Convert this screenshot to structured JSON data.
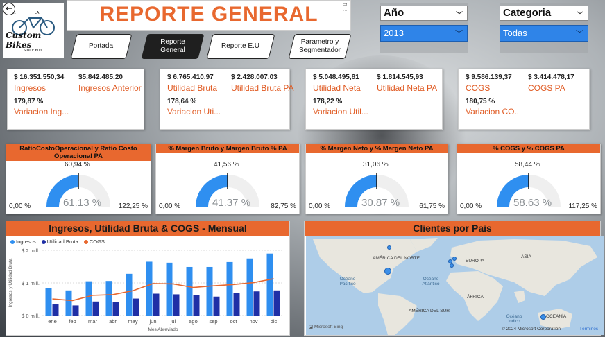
{
  "header": {
    "title": "REPORTE GENERAL",
    "logo": {
      "small_left": "CALIF.",
      "small_right": "LA.",
      "brand": "Custom Bikes",
      "since": "SINCE 60's"
    }
  },
  "nav": {
    "buttons": [
      {
        "label": "Portada"
      },
      {
        "label": "Reporte General"
      },
      {
        "label": "Reporte E.U"
      },
      {
        "label": "Parametro y Segmentador"
      }
    ]
  },
  "slicers": {
    "year": {
      "label": "Año",
      "value": "2013"
    },
    "category": {
      "label": "Categoria",
      "value": "Todas"
    }
  },
  "kpi_cards": [
    {
      "v1": "$ 16.351.550,34",
      "l1": "Ingresos",
      "v2": "$5.842.485,20",
      "l2": "Ingresos Anterior",
      "v3": "179,87 %",
      "l3": "Variacion Ing..."
    },
    {
      "v1": "$ 6.765.410,97",
      "l1": "Utilidad Bruta",
      "v2": "$ 2.428.007,03",
      "l2": "Utilidad Bruta PA",
      "v3": "178,64 %",
      "l3": "Variacion Uti..."
    },
    {
      "v1": "$ 5.048.495,81",
      "l1": "Utilidad Neta",
      "v2": "$ 1.814.545,93",
      "l2": "Utilidad Neta PA",
      "v3": "178,22 %",
      "l3": "Variacion Util..."
    },
    {
      "v1": "$ 9.586.139,37",
      "l1": "COGS",
      "v2": "$ 3.414.478,17",
      "l2": "COGS PA",
      "v3": "180,75 %",
      "l3": "Variacion CO..."
    }
  ],
  "gauges": [
    {
      "title": "RatioCostoOperacional y Ratio Costo Operacional PA",
      "min": "0,00 %",
      "max": "122,25 %",
      "target": "60,94 %",
      "center": "61.13 %",
      "fill": 0.5
    },
    {
      "title": "% Margen Bruto y Margen Bruto % PA",
      "min": "0,00 %",
      "max": "82,75 %",
      "target": "41,56 %",
      "center": "41.37 %",
      "fill": 0.5
    },
    {
      "title": "% Margen Neto y % Margen Neto PA",
      "min": "0,00 %",
      "max": "61,75 %",
      "target": "31,06 %",
      "center": "30.87 %",
      "fill": 0.5
    },
    {
      "title": "% COGS y % COGS PA",
      "min": "0,00 %",
      "max": "117,25 %",
      "target": "58,44 %",
      "center": "58.63 %",
      "fill": 0.5
    }
  ],
  "chart_panel": {
    "title": "Ingresos, Utilidad Bruta & COGS - Mensual",
    "legend": [
      "Ingresos",
      "Utilidad Bruta",
      "COGS"
    ]
  },
  "colors": {
    "accent": "#e8682f",
    "ingresos": "#2f8ff0",
    "utilidad": "#1f2fa6",
    "cogs": "#e8682f"
  },
  "chart_data": {
    "type": "bar",
    "title": "Ingresos, Utilidad Bruta & COGS - Mensual",
    "xlabel": "Mes Abreviado",
    "ylabel": "Ingresos y Utilidad Bruta",
    "yticks": [
      "$ 0 mill.",
      "$ 1 mill.",
      "$ 2 mill."
    ],
    "ylim": [
      0,
      2.0
    ],
    "categories": [
      "ene",
      "feb",
      "mar",
      "abr",
      "may",
      "jun",
      "jul",
      "ago",
      "sep",
      "oct",
      "nov",
      "dic"
    ],
    "series": [
      {
        "name": "Ingresos",
        "type": "bar",
        "values": [
          0.85,
          0.77,
          1.05,
          1.06,
          1.28,
          1.65,
          1.62,
          1.49,
          1.49,
          1.64,
          1.75,
          1.9
        ]
      },
      {
        "name": "Utilidad Bruta",
        "type": "bar",
        "values": [
          0.34,
          0.31,
          0.43,
          0.42,
          0.52,
          0.67,
          0.65,
          0.63,
          0.58,
          0.69,
          0.74,
          0.77
        ]
      },
      {
        "name": "COGS",
        "type": "line",
        "values": [
          0.51,
          0.46,
          0.62,
          0.64,
          0.76,
          0.98,
          0.97,
          0.86,
          0.91,
          0.95,
          1.01,
          1.13
        ]
      }
    ]
  },
  "map_panel": {
    "title": "Clientes por Pais",
    "labels": [
      "AMÉRICA DEL NORTE",
      "EUROPA",
      "ASIA",
      "ÁFRICA",
      "AMÉRICA DEL SUR",
      "OCEANÍA"
    ],
    "seas": [
      "Océano Pacífico",
      "Océano Atlántico",
      "Océano Índico"
    ],
    "attribution": "© 2024 Microsoft Corporation",
    "terms": "Términos",
    "bing": "Microsoft Bing"
  }
}
